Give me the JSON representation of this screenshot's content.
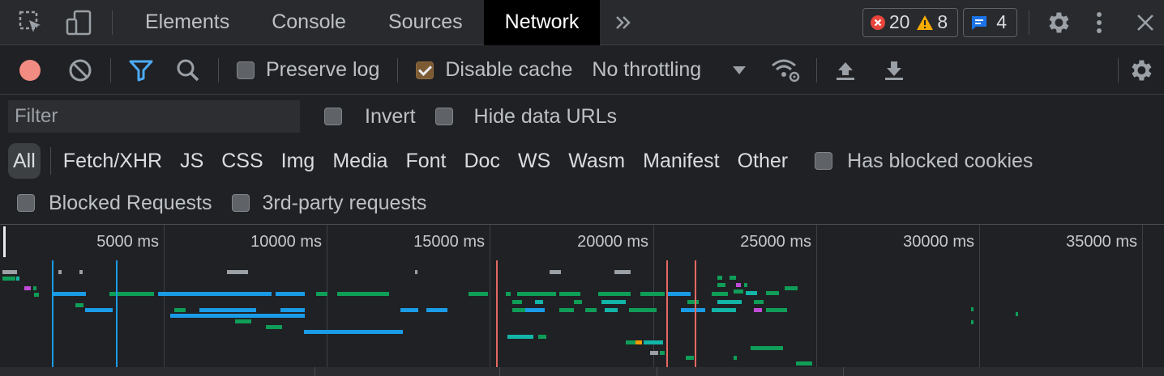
{
  "tabs": {
    "items": [
      {
        "label": "Elements"
      },
      {
        "label": "Console"
      },
      {
        "label": "Sources"
      },
      {
        "label": "Network"
      }
    ],
    "active": "Network",
    "more_icon": "double-chevron-icon"
  },
  "counters": {
    "errors": "20",
    "warnings": "8",
    "messages": "4"
  },
  "toolbar": {
    "preserve_log": "Preserve log",
    "disable_cache": "Disable cache",
    "disable_cache_checked": true,
    "preserve_log_checked": false,
    "throttling": "No throttling"
  },
  "filter": {
    "placeholder": "Filter",
    "invert": "Invert",
    "hide_data_urls": "Hide data URLs"
  },
  "types": [
    "All",
    "Fetch/XHR",
    "JS",
    "CSS",
    "Img",
    "Media",
    "Font",
    "Doc",
    "WS",
    "Wasm",
    "Manifest",
    "Other"
  ],
  "active_type": "All",
  "has_blocked_cookies": "Has blocked cookies",
  "blocked_requests": "Blocked Requests",
  "third_party": "3rd-party requests",
  "overview": {
    "tick_labels": [
      "5000 ms",
      "10000 ms",
      "15000 ms",
      "20000 ms",
      "25000 ms",
      "30000 ms",
      "35000 ms"
    ],
    "colors": {
      "blue": "#1a9be6",
      "green": "#0f9d58",
      "teal": "#12b5a8",
      "gray": "#9aa0a6",
      "purple": "#c04bd6",
      "orange": "#f29900",
      "red_marker": "#e46962",
      "blue_marker": "#1a9be6"
    }
  }
}
